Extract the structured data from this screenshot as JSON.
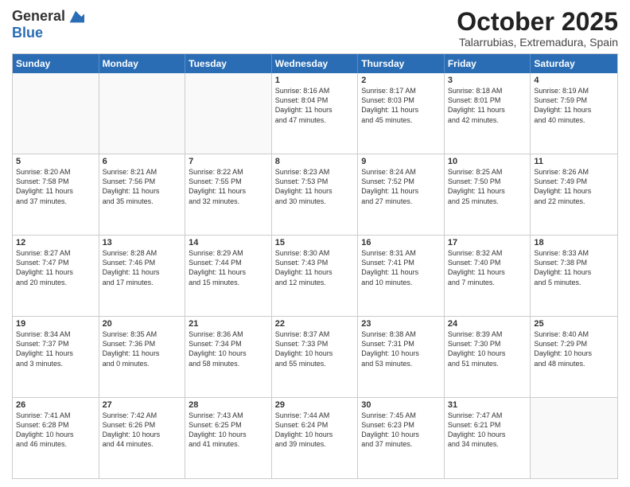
{
  "header": {
    "logo_general": "General",
    "logo_blue": "Blue",
    "month_title": "October 2025",
    "subtitle": "Talarrubias, Extremadura, Spain"
  },
  "weekdays": [
    "Sunday",
    "Monday",
    "Tuesday",
    "Wednesday",
    "Thursday",
    "Friday",
    "Saturday"
  ],
  "rows": [
    [
      {
        "day": "",
        "text": "",
        "empty": true
      },
      {
        "day": "",
        "text": "",
        "empty": true
      },
      {
        "day": "",
        "text": "",
        "empty": true
      },
      {
        "day": "1",
        "text": "Sunrise: 8:16 AM\nSunset: 8:04 PM\nDaylight: 11 hours\nand 47 minutes.",
        "empty": false
      },
      {
        "day": "2",
        "text": "Sunrise: 8:17 AM\nSunset: 8:03 PM\nDaylight: 11 hours\nand 45 minutes.",
        "empty": false
      },
      {
        "day": "3",
        "text": "Sunrise: 8:18 AM\nSunset: 8:01 PM\nDaylight: 11 hours\nand 42 minutes.",
        "empty": false
      },
      {
        "day": "4",
        "text": "Sunrise: 8:19 AM\nSunset: 7:59 PM\nDaylight: 11 hours\nand 40 minutes.",
        "empty": false
      }
    ],
    [
      {
        "day": "5",
        "text": "Sunrise: 8:20 AM\nSunset: 7:58 PM\nDaylight: 11 hours\nand 37 minutes.",
        "empty": false
      },
      {
        "day": "6",
        "text": "Sunrise: 8:21 AM\nSunset: 7:56 PM\nDaylight: 11 hours\nand 35 minutes.",
        "empty": false
      },
      {
        "day": "7",
        "text": "Sunrise: 8:22 AM\nSunset: 7:55 PM\nDaylight: 11 hours\nand 32 minutes.",
        "empty": false
      },
      {
        "day": "8",
        "text": "Sunrise: 8:23 AM\nSunset: 7:53 PM\nDaylight: 11 hours\nand 30 minutes.",
        "empty": false
      },
      {
        "day": "9",
        "text": "Sunrise: 8:24 AM\nSunset: 7:52 PM\nDaylight: 11 hours\nand 27 minutes.",
        "empty": false
      },
      {
        "day": "10",
        "text": "Sunrise: 8:25 AM\nSunset: 7:50 PM\nDaylight: 11 hours\nand 25 minutes.",
        "empty": false
      },
      {
        "day": "11",
        "text": "Sunrise: 8:26 AM\nSunset: 7:49 PM\nDaylight: 11 hours\nand 22 minutes.",
        "empty": false
      }
    ],
    [
      {
        "day": "12",
        "text": "Sunrise: 8:27 AM\nSunset: 7:47 PM\nDaylight: 11 hours\nand 20 minutes.",
        "empty": false
      },
      {
        "day": "13",
        "text": "Sunrise: 8:28 AM\nSunset: 7:46 PM\nDaylight: 11 hours\nand 17 minutes.",
        "empty": false
      },
      {
        "day": "14",
        "text": "Sunrise: 8:29 AM\nSunset: 7:44 PM\nDaylight: 11 hours\nand 15 minutes.",
        "empty": false
      },
      {
        "day": "15",
        "text": "Sunrise: 8:30 AM\nSunset: 7:43 PM\nDaylight: 11 hours\nand 12 minutes.",
        "empty": false
      },
      {
        "day": "16",
        "text": "Sunrise: 8:31 AM\nSunset: 7:41 PM\nDaylight: 11 hours\nand 10 minutes.",
        "empty": false
      },
      {
        "day": "17",
        "text": "Sunrise: 8:32 AM\nSunset: 7:40 PM\nDaylight: 11 hours\nand 7 minutes.",
        "empty": false
      },
      {
        "day": "18",
        "text": "Sunrise: 8:33 AM\nSunset: 7:38 PM\nDaylight: 11 hours\nand 5 minutes.",
        "empty": false
      }
    ],
    [
      {
        "day": "19",
        "text": "Sunrise: 8:34 AM\nSunset: 7:37 PM\nDaylight: 11 hours\nand 3 minutes.",
        "empty": false
      },
      {
        "day": "20",
        "text": "Sunrise: 8:35 AM\nSunset: 7:36 PM\nDaylight: 11 hours\nand 0 minutes.",
        "empty": false
      },
      {
        "day": "21",
        "text": "Sunrise: 8:36 AM\nSunset: 7:34 PM\nDaylight: 10 hours\nand 58 minutes.",
        "empty": false
      },
      {
        "day": "22",
        "text": "Sunrise: 8:37 AM\nSunset: 7:33 PM\nDaylight: 10 hours\nand 55 minutes.",
        "empty": false
      },
      {
        "day": "23",
        "text": "Sunrise: 8:38 AM\nSunset: 7:31 PM\nDaylight: 10 hours\nand 53 minutes.",
        "empty": false
      },
      {
        "day": "24",
        "text": "Sunrise: 8:39 AM\nSunset: 7:30 PM\nDaylight: 10 hours\nand 51 minutes.",
        "empty": false
      },
      {
        "day": "25",
        "text": "Sunrise: 8:40 AM\nSunset: 7:29 PM\nDaylight: 10 hours\nand 48 minutes.",
        "empty": false
      }
    ],
    [
      {
        "day": "26",
        "text": "Sunrise: 7:41 AM\nSunset: 6:28 PM\nDaylight: 10 hours\nand 46 minutes.",
        "empty": false
      },
      {
        "day": "27",
        "text": "Sunrise: 7:42 AM\nSunset: 6:26 PM\nDaylight: 10 hours\nand 44 minutes.",
        "empty": false
      },
      {
        "day": "28",
        "text": "Sunrise: 7:43 AM\nSunset: 6:25 PM\nDaylight: 10 hours\nand 41 minutes.",
        "empty": false
      },
      {
        "day": "29",
        "text": "Sunrise: 7:44 AM\nSunset: 6:24 PM\nDaylight: 10 hours\nand 39 minutes.",
        "empty": false
      },
      {
        "day": "30",
        "text": "Sunrise: 7:45 AM\nSunset: 6:23 PM\nDaylight: 10 hours\nand 37 minutes.",
        "empty": false
      },
      {
        "day": "31",
        "text": "Sunrise: 7:47 AM\nSunset: 6:21 PM\nDaylight: 10 hours\nand 34 minutes.",
        "empty": false
      },
      {
        "day": "",
        "text": "",
        "empty": true
      }
    ]
  ]
}
